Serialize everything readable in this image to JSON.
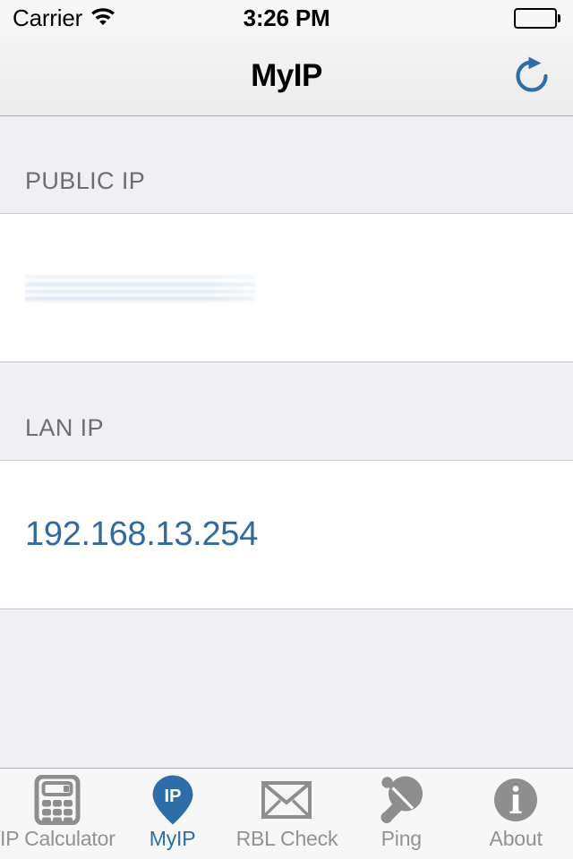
{
  "status_bar": {
    "carrier": "Carrier",
    "wifi_icon": "wifi-icon",
    "time": "3:26 PM",
    "battery_icon": "battery-full-icon"
  },
  "nav_bar": {
    "title": "MyIP",
    "refresh_icon": "refresh-icon"
  },
  "sections": [
    {
      "header": "PUBLIC IP",
      "value": "",
      "redacted": true,
      "redacted_note": "blurred"
    },
    {
      "header": "LAN IP",
      "value": "192.168.13.254",
      "redacted": false
    }
  ],
  "tabs": [
    {
      "label": "IP Calculator",
      "icon": "calculator-icon",
      "active": false
    },
    {
      "label": "MyIP",
      "icon": "map-pin-ip-icon",
      "active": true
    },
    {
      "label": "RBL Check",
      "icon": "envelope-icon",
      "active": false
    },
    {
      "label": "Ping",
      "icon": "ping-pong-paddle-icon",
      "active": false
    },
    {
      "label": "About",
      "icon": "info-circle-icon",
      "active": false
    }
  ],
  "colors": {
    "accent_blue": "#2e6da8",
    "value_blue": "#34699e",
    "inactive_gray": "#929292",
    "section_header_gray": "#6d6d72",
    "table_background": "#efeff4",
    "cell_background": "#ffffff",
    "separator": "#c8c7cc"
  }
}
